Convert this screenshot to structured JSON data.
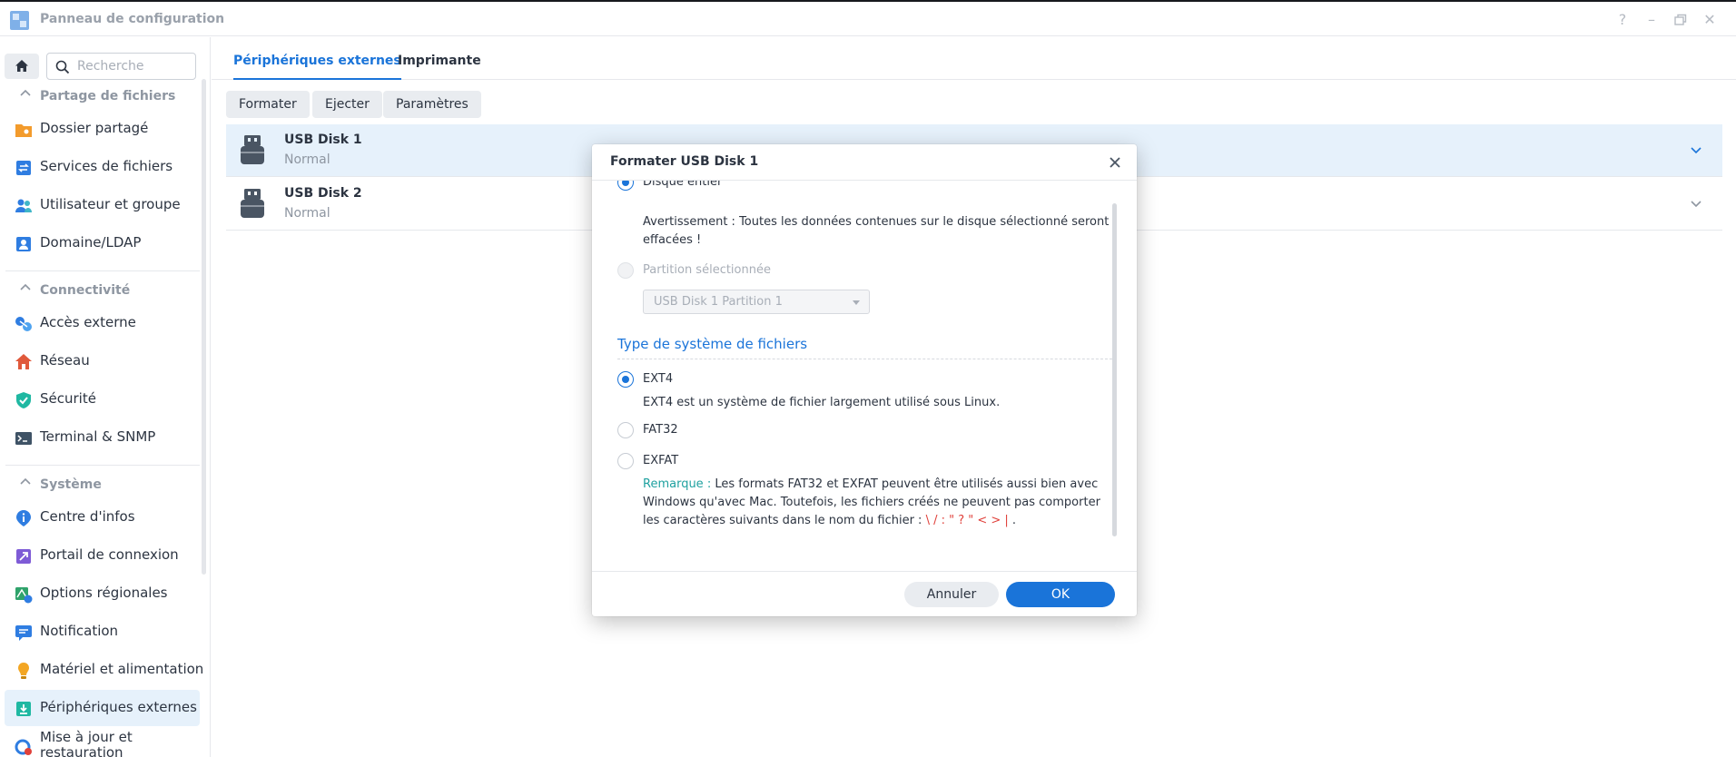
{
  "window": {
    "title": "Panneau de configuration",
    "controls": [
      "help-icon",
      "minimize-icon",
      "restore-icon",
      "close-icon"
    ]
  },
  "sidebar": {
    "search_placeholder": "Recherche",
    "sections": [
      {
        "title": "Partage de fichiers",
        "items": [
          {
            "label": "Dossier partagé",
            "icon": "shared-folder-icon"
          },
          {
            "label": "Services de fichiers",
            "icon": "file-services-icon"
          },
          {
            "label": "Utilisateur et groupe",
            "icon": "user-group-icon"
          },
          {
            "label": "Domaine/LDAP",
            "icon": "domain-ldap-icon"
          }
        ]
      },
      {
        "title": "Connectivité",
        "items": [
          {
            "label": "Accès externe",
            "icon": "external-access-icon"
          },
          {
            "label": "Réseau",
            "icon": "network-icon"
          },
          {
            "label": "Sécurité",
            "icon": "security-shield-icon"
          },
          {
            "label": "Terminal & SNMP",
            "icon": "terminal-icon"
          }
        ]
      },
      {
        "title": "Système",
        "items": [
          {
            "label": "Centre d'infos",
            "icon": "info-center-icon"
          },
          {
            "label": "Portail de connexion",
            "icon": "login-portal-icon"
          },
          {
            "label": "Options régionales",
            "icon": "regional-options-icon"
          },
          {
            "label": "Notification",
            "icon": "notification-icon"
          },
          {
            "label": "Matériel et alimentation",
            "icon": "hardware-power-icon"
          },
          {
            "label": "Périphériques externes",
            "icon": "external-devices-icon",
            "active": true
          },
          {
            "label": "Mise à jour et restauration",
            "icon": "update-restore-icon"
          }
        ]
      }
    ]
  },
  "main": {
    "tabs": [
      {
        "label": "Périphériques externes",
        "active": true
      },
      {
        "label": "Imprimante",
        "active": false
      }
    ],
    "toolbar": {
      "format_label": "Formater",
      "eject_label": "Ejecter",
      "settings_label": "Paramètres"
    },
    "disks": [
      {
        "name": "USB Disk 1",
        "status": "Normal",
        "selected": true
      },
      {
        "name": "USB Disk 2",
        "status": "Normal",
        "selected": false
      }
    ]
  },
  "dialog": {
    "title": "Formater USB Disk 1",
    "whole_disk_label": "Disque entier",
    "warning": "Avertissement : Toutes les données contenues sur le disque sélectionné seront effacées !",
    "partition_label": "Partition sélectionnée",
    "partition_select_value": "USB Disk 1 Partition 1",
    "fs_group_title": "Type de système de fichiers",
    "fs_options": [
      {
        "label": "EXT4",
        "checked": true
      },
      {
        "label": "FAT32",
        "checked": false
      },
      {
        "label": "EXFAT",
        "checked": false
      }
    ],
    "ext4_description": "EXT4 est un système de fichier largement utilisé sous Linux.",
    "note_key": "Remarque :",
    "note_text": " Les formats FAT32 et EXFAT peuvent être utilisés aussi bien avec Windows qu'avec Mac. Toutefois, les fichiers créés ne peuvent pas comporter les caractères suivants dans le nom du fichier : ",
    "note_chars": "\\ / : \" ? \" < > |",
    "note_end": " .",
    "cancel_label": "Annuler",
    "ok_label": "OK"
  },
  "colors": {
    "accent": "#1a74d9",
    "selected_row": "#e6f1fb",
    "note_key": "#1fa1a0",
    "note_chars": "#e0413b"
  }
}
